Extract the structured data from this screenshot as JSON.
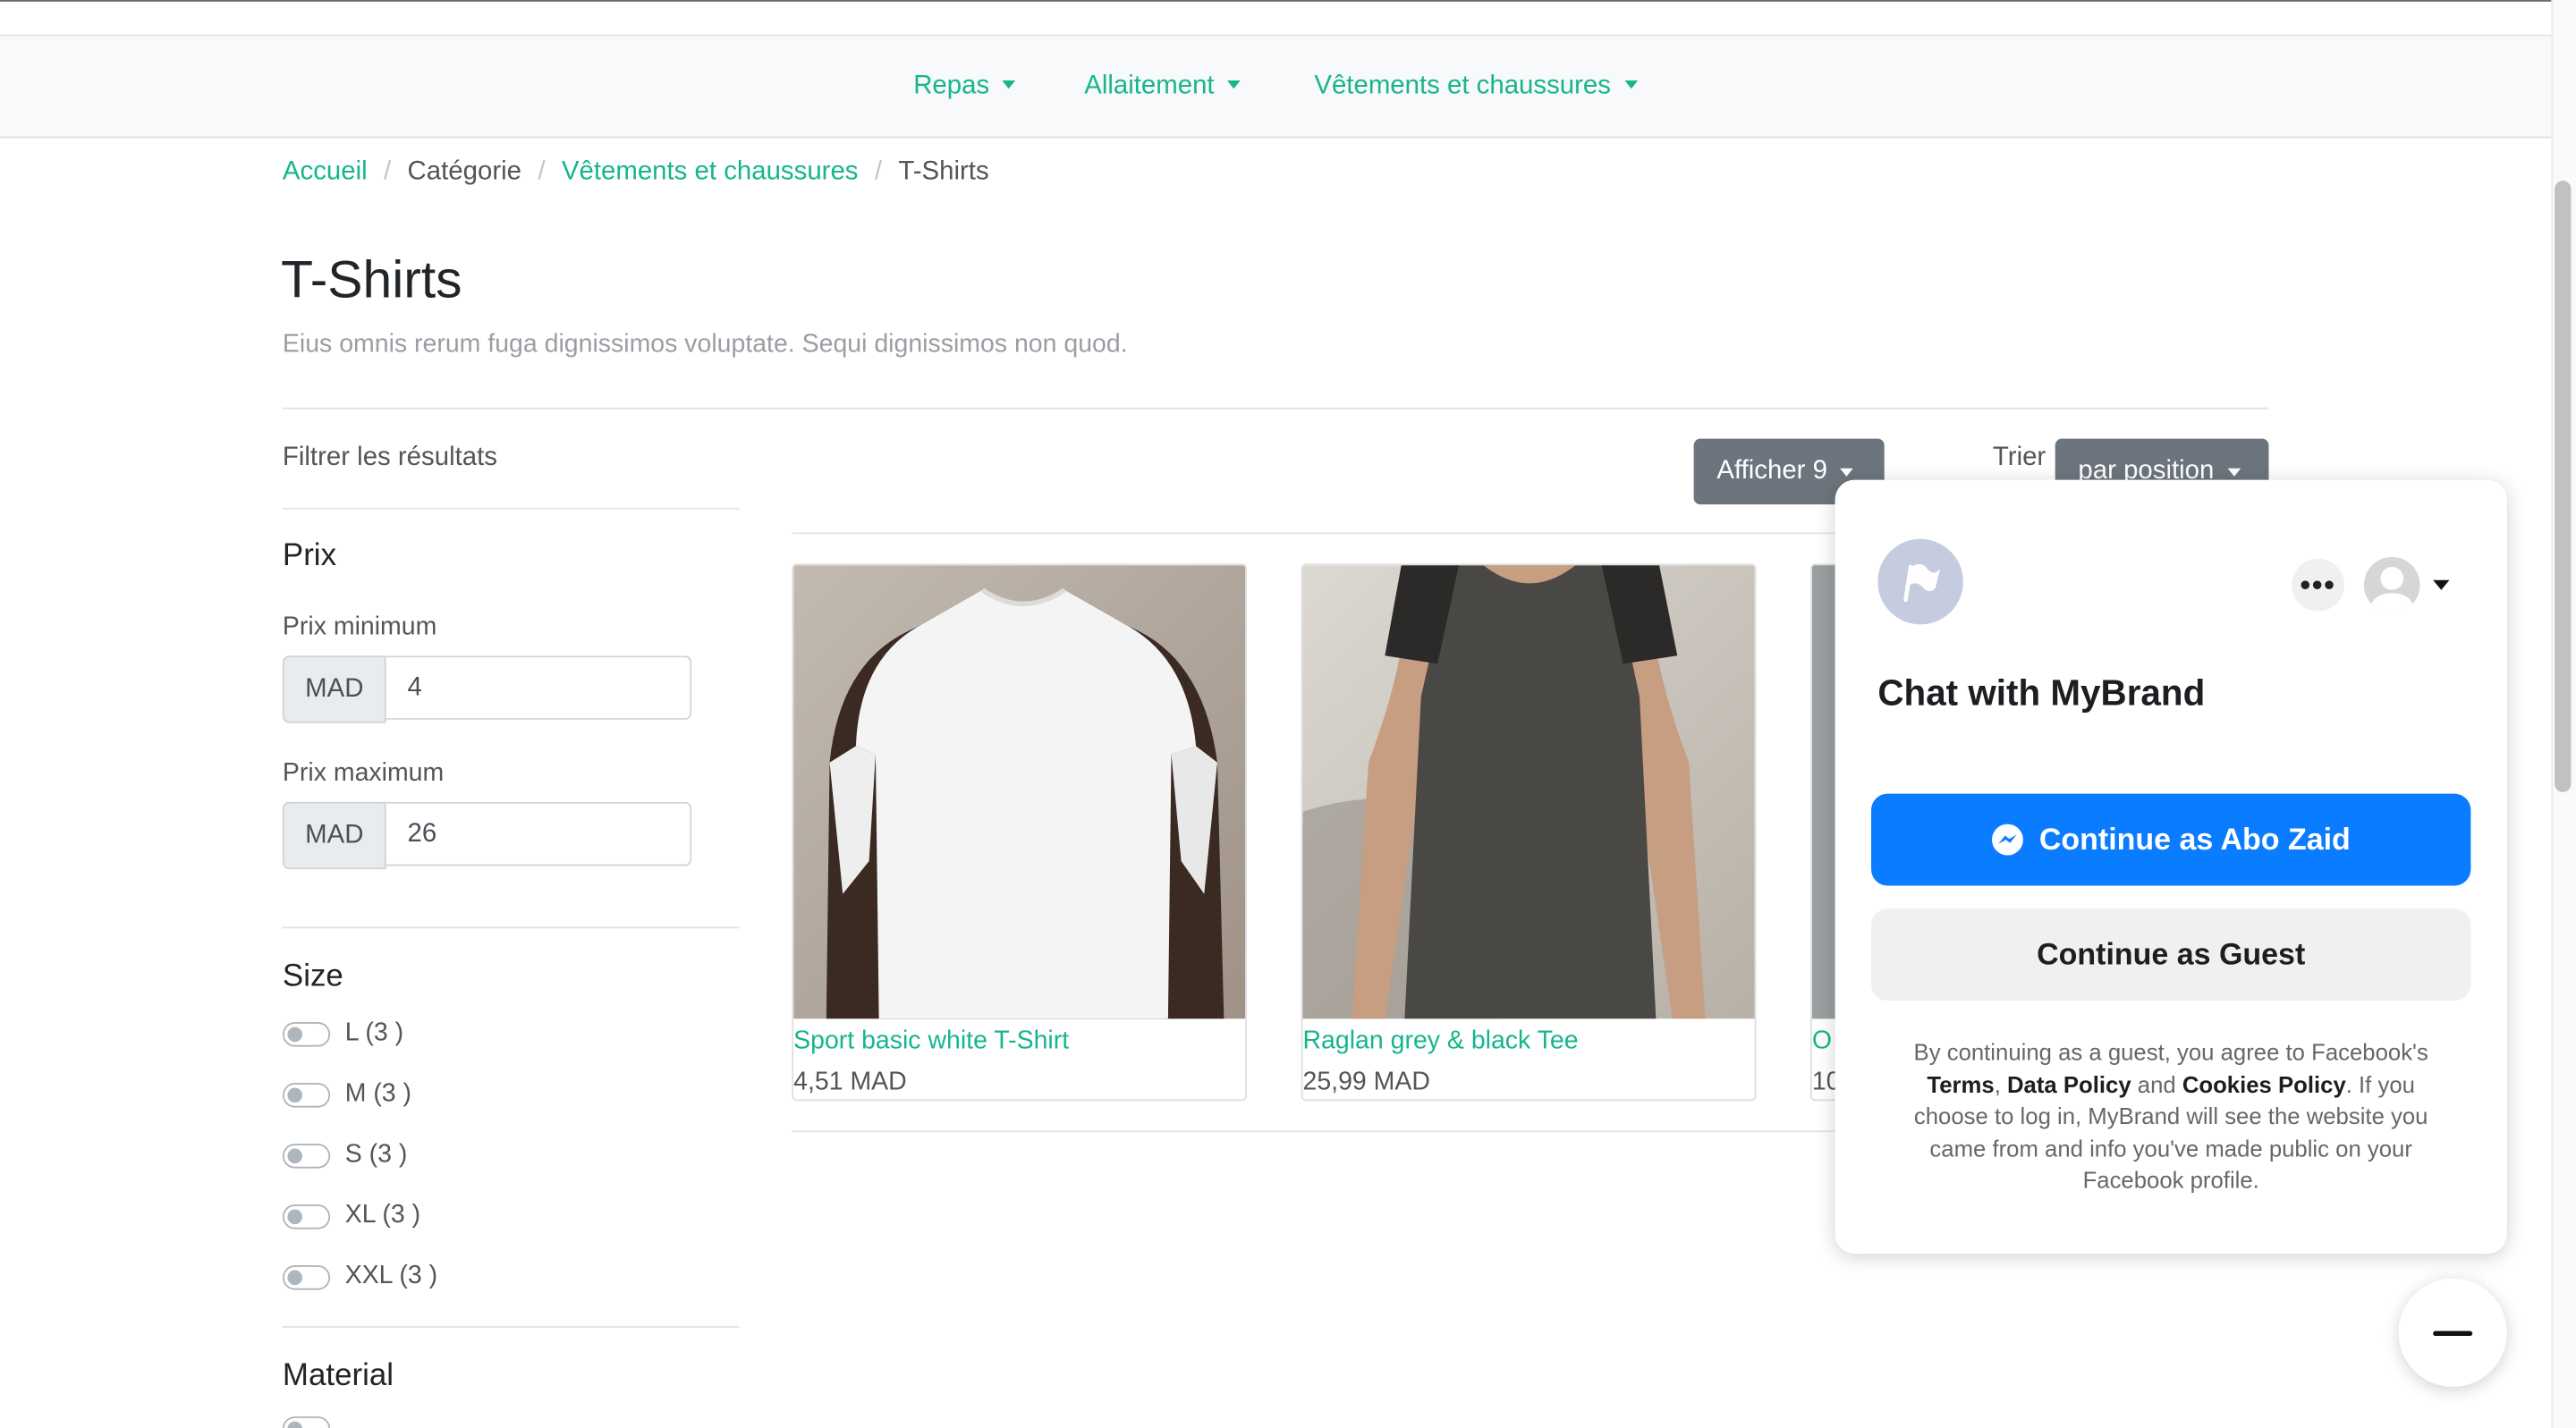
{
  "nav": {
    "items": [
      {
        "label": "Repas"
      },
      {
        "label": "Allaitement"
      },
      {
        "label": "Vêtements et chaussures"
      }
    ]
  },
  "breadcrumb": {
    "home": "Accueil",
    "category": "Catégorie",
    "parent": "Vêtements et chaussures",
    "current": "T-Shirts"
  },
  "page": {
    "title": "T-Shirts",
    "description": "Eius omnis rerum fuga dignissimos voluptate. Sequi dignissimos non quod."
  },
  "filters": {
    "heading": "Filtrer les résultats",
    "price": {
      "title": "Prix",
      "min_label": "Prix minimum",
      "max_label": "Prix maximum",
      "currency": "MAD",
      "min_value": "4",
      "max_value": "26"
    },
    "size": {
      "title": "Size",
      "options": [
        "L (3 )",
        "M (3 )",
        "S (3 )",
        "XL (3 )",
        "XXL (3 )"
      ]
    },
    "material": {
      "title": "Material"
    }
  },
  "toolbar": {
    "show_label": "Afficher 9",
    "sort_label": "Trier",
    "sort_value": "par position"
  },
  "products": [
    {
      "title": "Sport basic white T-Shirt",
      "price": "4,51 MAD"
    },
    {
      "title": "Raglan grey & black Tee",
      "price": "25,99 MAD"
    },
    {
      "title": "O",
      "price": "10"
    }
  ],
  "chat": {
    "title": "Chat with MyBrand",
    "continue_user": "Continue as Abo Zaid",
    "continue_guest": "Continue as Guest",
    "legal_1": "By continuing as a guest, you agree to Facebook's ",
    "terms": "Terms",
    "comma": ", ",
    "data_policy": "Data Policy",
    "and": " and ",
    "cookies": "Cookies Policy",
    "legal_2": ". If you choose to log in, MyBrand will see the website you came from and info you've made public on your Facebook profile."
  },
  "colors": {
    "accent": "#17b58e",
    "messenger_blue": "#0a7cff",
    "button_dark": "#6c757d"
  }
}
